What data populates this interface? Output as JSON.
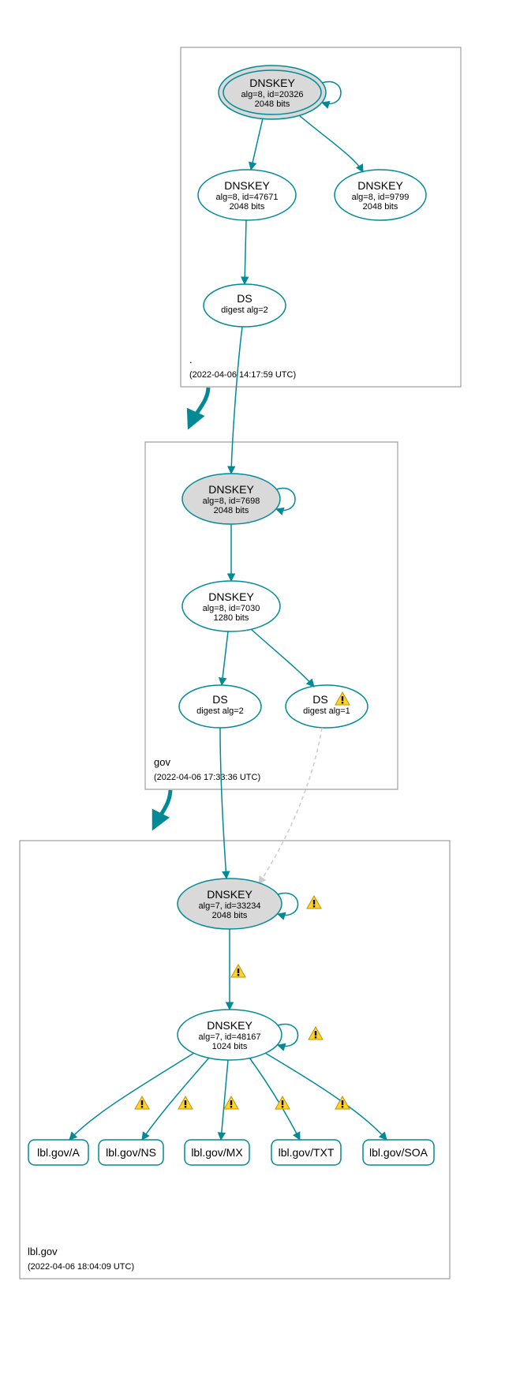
{
  "zones": {
    "root": {
      "label": ".",
      "timestamp": "(2022-04-06 14:17:59 UTC)"
    },
    "gov": {
      "label": "gov",
      "timestamp": "(2022-04-06 17:33:36 UTC)"
    },
    "lblgov": {
      "label": "lbl.gov",
      "timestamp": "(2022-04-06 18:04:09 UTC)"
    }
  },
  "nodes": {
    "root_ksk": {
      "title": "DNSKEY",
      "sub1": "alg=8, id=20326",
      "sub2": "2048 bits"
    },
    "root_zsk1": {
      "title": "DNSKEY",
      "sub1": "alg=8, id=47671",
      "sub2": "2048 bits"
    },
    "root_zsk2": {
      "title": "DNSKEY",
      "sub1": "alg=8, id=9799",
      "sub2": "2048 bits"
    },
    "root_ds": {
      "title": "DS",
      "sub1": "digest alg=2"
    },
    "gov_ksk": {
      "title": "DNSKEY",
      "sub1": "alg=8, id=7698",
      "sub2": "2048 bits"
    },
    "gov_zsk": {
      "title": "DNSKEY",
      "sub1": "alg=8, id=7030",
      "sub2": "1280 bits"
    },
    "gov_ds1": {
      "title": "DS",
      "sub1": "digest alg=2"
    },
    "gov_ds2": {
      "title": "DS",
      "sub1": "digest alg=1"
    },
    "lbl_ksk": {
      "title": "DNSKEY",
      "sub1": "alg=7, id=33234",
      "sub2": "2048 bits"
    },
    "lbl_zsk": {
      "title": "DNSKEY",
      "sub1": "alg=7, id=48167",
      "sub2": "1024 bits"
    },
    "lbl_a": {
      "title": "lbl.gov/A"
    },
    "lbl_ns": {
      "title": "lbl.gov/NS"
    },
    "lbl_mx": {
      "title": "lbl.gov/MX"
    },
    "lbl_txt": {
      "title": "lbl.gov/TXT"
    },
    "lbl_soa": {
      "title": "lbl.gov/SOA"
    }
  },
  "warning_icon": "⚠"
}
